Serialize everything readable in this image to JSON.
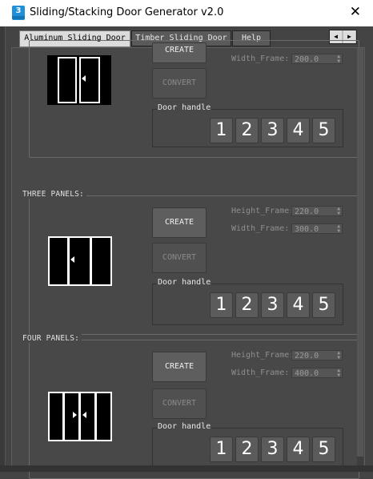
{
  "window": {
    "title": "Sliding/Stacking Door Generator v2.0",
    "app_icon_text": "3"
  },
  "tabs": [
    "Aluminum Sliding Door",
    "Timber Sliding Door",
    "Help"
  ],
  "groups": [
    {
      "label": "",
      "create": "CREATE",
      "convert": "CONVERT",
      "width_label": "Width_Frame:",
      "width_value": "200.0",
      "handle_label": "Door handle",
      "handles": [
        "1",
        "2",
        "3",
        "4",
        "5"
      ],
      "panels": 2
    },
    {
      "label": "THREE PANELS:",
      "create": "CREATE",
      "convert": "CONVERT",
      "height_label": "Height_Frame:",
      "height_value": "220.0",
      "width_label": "Width_Frame:",
      "width_value": "300.0",
      "handle_label": "Door handle",
      "handles": [
        "1",
        "2",
        "3",
        "4",
        "5"
      ],
      "panels": 3
    },
    {
      "label": "FOUR PANELS:",
      "create": "CREATE",
      "convert": "CONVERT",
      "height_label": "Height_Frame:",
      "height_value": "220.0",
      "width_label": "Width_Frame:",
      "width_value": "400.0",
      "handle_label": "Door handle",
      "handles": [
        "1",
        "2",
        "3",
        "4",
        "5"
      ],
      "panels": 4
    }
  ]
}
